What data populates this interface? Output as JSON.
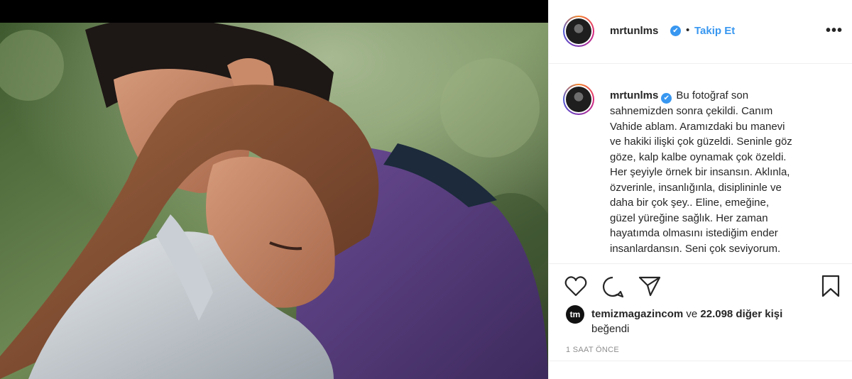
{
  "post": {
    "username": "mrtunlms",
    "verified_mark": "✔",
    "separator": "•",
    "follow_label": "Takip Et",
    "more_label": "•••",
    "photo_icon": "embracing-couple-photo",
    "caption_lines": [
      "Bu fotoğraf son",
      "sahnemizden sonra çekildi. Canım",
      "Vahide ablam. Aramızdaki bu manevi",
      "ve hakiki ilişki çok güzeldi. Seninle göz",
      "göze, kalp kalbe oynamak çok özeldi.",
      "Her şeyiyle örnek bir insansın. Aklınla,",
      "özverinle, insanlığınla, disiplininle ve",
      "daha bir çok şey.. Eline, emeğine,",
      "güzel yüreğine sağlık. Her zaman",
      "hayatımda olmasını istediğim ender",
      "insanlardansın. Seni çok seviyorum."
    ]
  },
  "actions": {
    "icons": [
      "heart-icon",
      "comment-icon",
      "share-icon",
      "bookmark-icon"
    ]
  },
  "likes": {
    "avatar_letter": "tm",
    "liker": "temizmagazincom",
    "connector": "ve",
    "others": "22.098 diğer kişi",
    "suffix": "beğendi"
  },
  "timestamp": "1 SAAT ÖNCE",
  "colors": {
    "accent": "#3897f0",
    "text": "#262626",
    "muted": "#8e8e8e",
    "divider": "#efefef"
  }
}
